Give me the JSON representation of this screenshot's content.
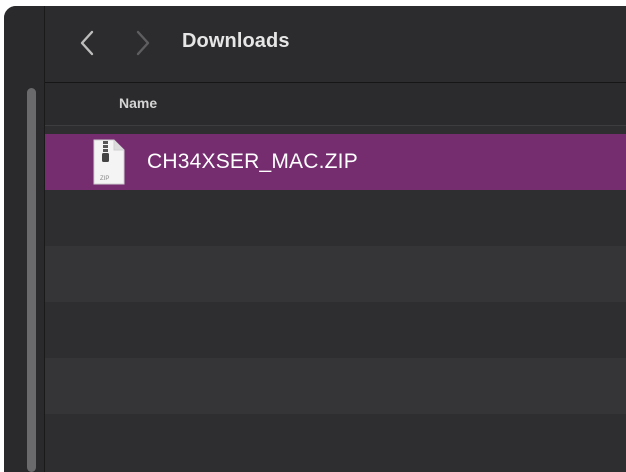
{
  "toolbar": {
    "back_icon": "chevron-left-icon",
    "forward_icon": "chevron-right-icon",
    "title": "Downloads"
  },
  "columns": {
    "name": "Name"
  },
  "files": [
    {
      "name": "CH34XSER_MAC.ZIP",
      "icon": "zip-file-icon",
      "icon_badge": "ZIP",
      "selected": true
    }
  ],
  "colors": {
    "selection": "#752d70",
    "window_bg": "#2e2e30",
    "alt_row": "#353537"
  }
}
